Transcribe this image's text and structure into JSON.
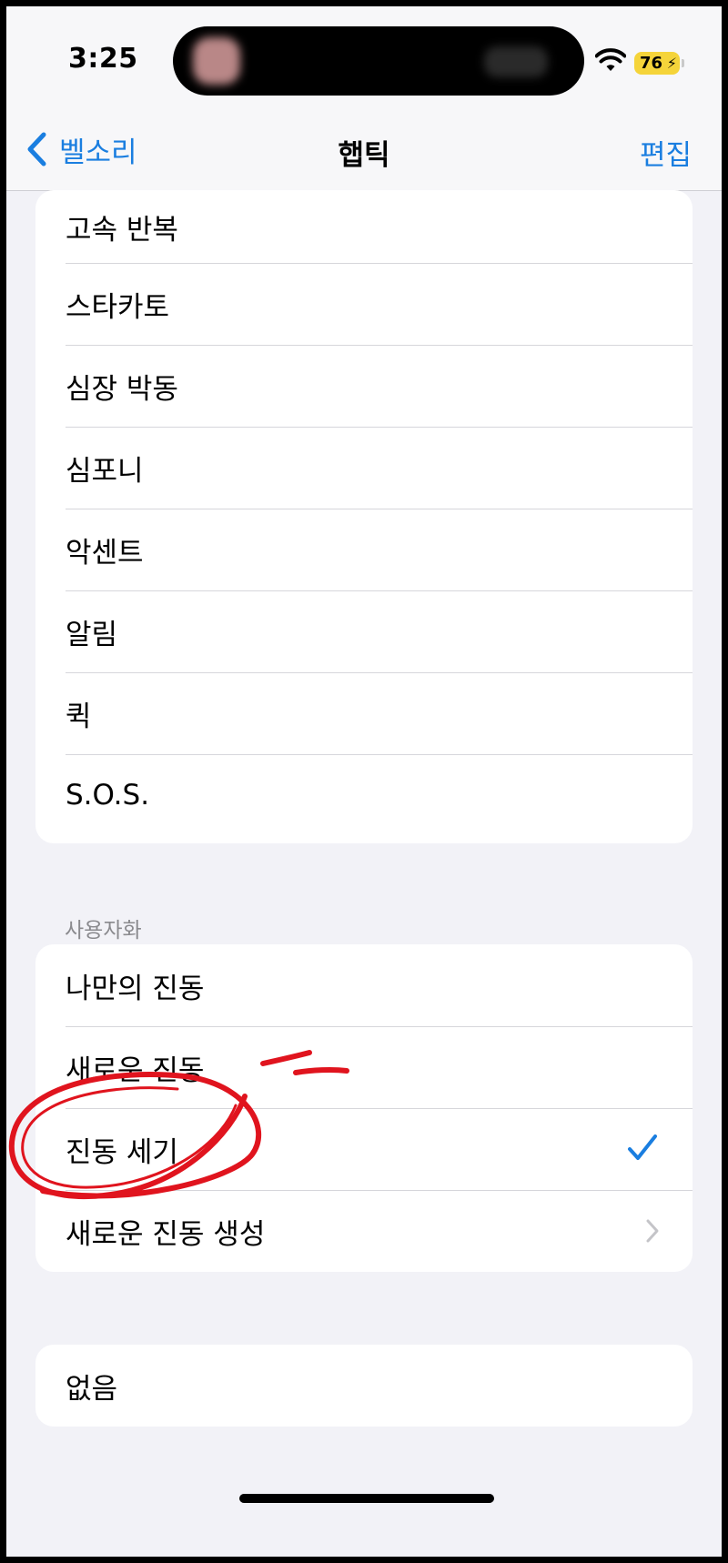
{
  "status_bar": {
    "time": "3:25",
    "battery": "76"
  },
  "nav": {
    "back_label": "벨소리",
    "title": "햅틱",
    "edit_label": "편집"
  },
  "standard_group": {
    "items": [
      {
        "label": "고속 반복"
      },
      {
        "label": "스타카토"
      },
      {
        "label": "심장 박동"
      },
      {
        "label": "심포니"
      },
      {
        "label": "악센트"
      },
      {
        "label": "알림"
      },
      {
        "label": "퀵"
      },
      {
        "label": "S.O.S."
      }
    ]
  },
  "custom_section": {
    "header": "사용자화",
    "items": [
      {
        "label": "나만의 진동",
        "selected": false
      },
      {
        "label": "새로운 진동",
        "selected": false
      },
      {
        "label": "진동 세기",
        "selected": true
      },
      {
        "label": "새로운 진동 생성",
        "selected": false
      }
    ]
  },
  "none_group": {
    "label": "없음"
  },
  "colors": {
    "accent": "#1a7ee0",
    "background": "#f2f2f7",
    "annotation": "#e0141e"
  },
  "icons": {
    "back": "chevron-left-icon",
    "check": "checkmark-icon",
    "disclosure": "chevron-right-icon",
    "wifi": "wifi-icon"
  }
}
